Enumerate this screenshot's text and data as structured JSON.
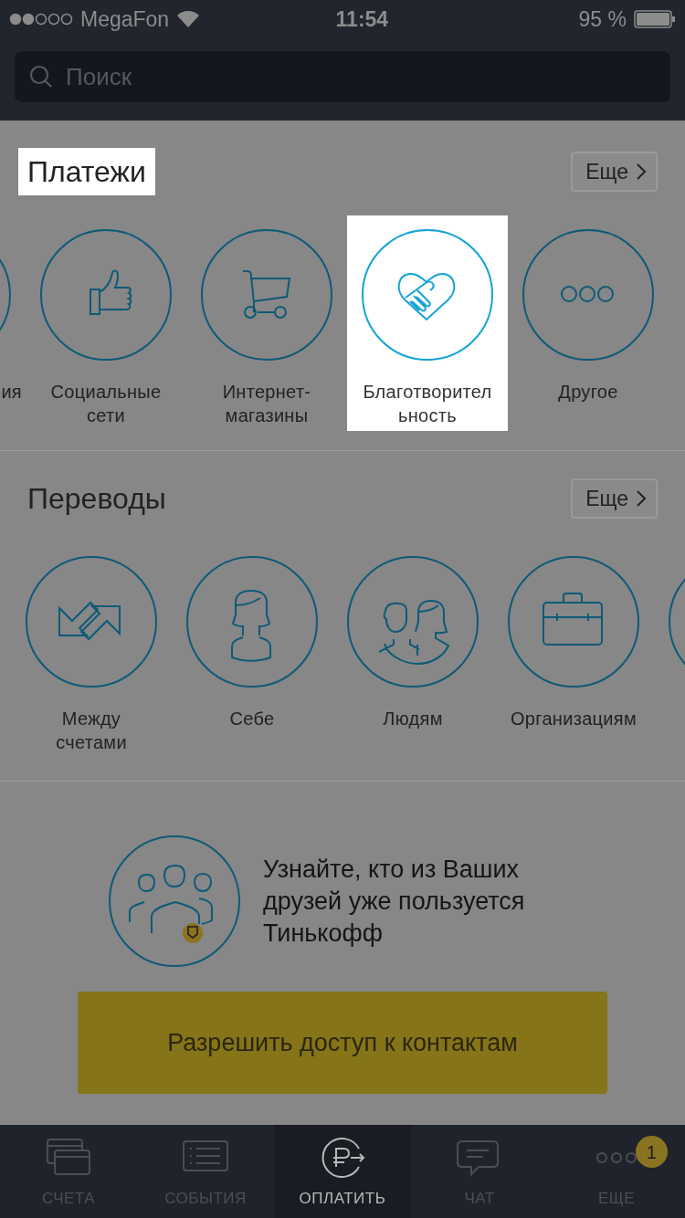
{
  "status_bar": {
    "carrier": "MegaFon",
    "time": "11:54",
    "battery": "95 %"
  },
  "search": {
    "placeholder": "Поиск"
  },
  "sections": [
    {
      "title": "Платежи",
      "highlighted": true,
      "more_button": "Еще",
      "items": [
        {
          "kind": "cut-left",
          "label": "ия",
          "highlighted": false
        },
        {
          "kind": "thumb",
          "label": "Социальные\nсети",
          "highlighted": false
        },
        {
          "kind": "cart",
          "label": "Интернет-\nмагазины",
          "highlighted": false
        },
        {
          "kind": "charity",
          "label": "Благотворител\nьность",
          "highlighted": true
        },
        {
          "kind": "dots",
          "label": "Другое",
          "highlighted": false
        }
      ]
    },
    {
      "title": "Переводы",
      "highlighted": false,
      "more_button": "Еще",
      "items": [
        {
          "kind": "arrows",
          "label": "Между\nсчетами",
          "highlighted": false
        },
        {
          "kind": "person",
          "label": "Себе",
          "highlighted": false
        },
        {
          "kind": "people",
          "label": "Людям",
          "highlighted": false
        },
        {
          "kind": "briefcase",
          "label": "Организациям",
          "highlighted": false
        },
        {
          "kind": "cut-right",
          "highlighted": false
        }
      ]
    }
  ],
  "promo": {
    "text": "Узнайте, кто из Ваших друзей уже пользуется Тинькофф",
    "button": "Разрешить доступ к контактам"
  },
  "tab_bar": [
    {
      "kind": "cards",
      "label": "СЧЕТА",
      "selected": false
    },
    {
      "kind": "list",
      "label": "СОБЫТИЯ",
      "selected": false
    },
    {
      "kind": "pay",
      "label": "ОПЛАТИТЬ",
      "selected": true
    },
    {
      "kind": "chat",
      "label": "ЧАТ",
      "selected": false
    },
    {
      "kind": "more",
      "label": "ЕЩЕ",
      "selected": false,
      "badge": "1"
    }
  ]
}
